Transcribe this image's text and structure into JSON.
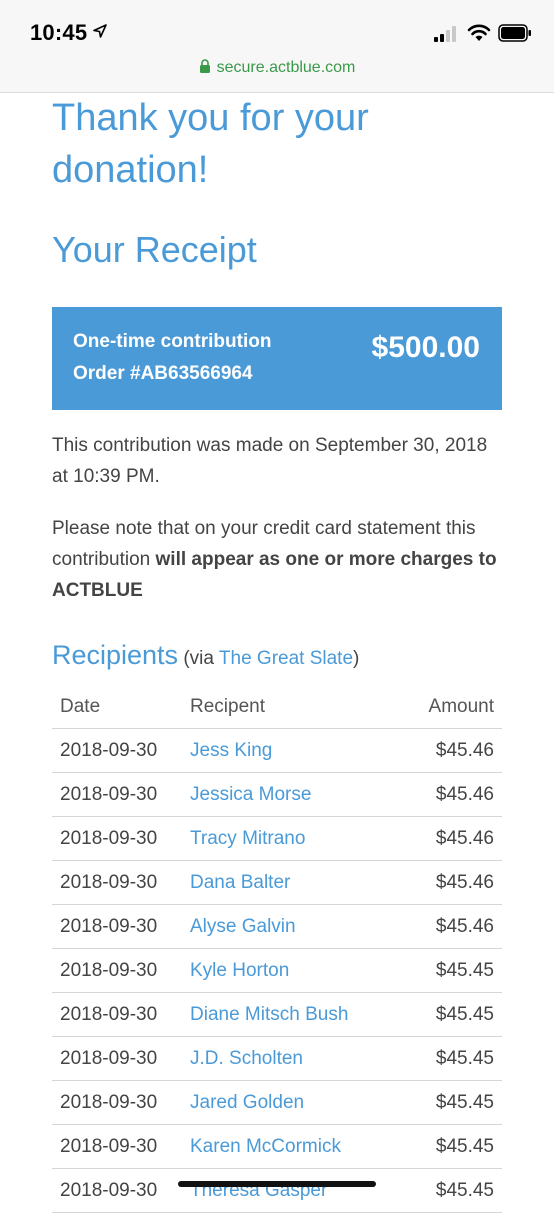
{
  "status_bar": {
    "time": "10:45",
    "icons": [
      "location-arrow-icon",
      "signal-bars-icon",
      "wifi-icon",
      "battery-icon"
    ]
  },
  "browser": {
    "url": "secure.actblue.com",
    "url_color": "#3a9a4a"
  },
  "page": {
    "heading_thank_you": "Thank you for your donation!",
    "heading_receipt": "Your Receipt",
    "accent_color": "#4a9ad8",
    "receipt": {
      "type": "One-time contribution",
      "order": "Order #AB63566964",
      "amount": "$500.00"
    },
    "contribution_made": "This contribution was made on September 30, 2018 at 10:39 PM.",
    "statement_note_prefix": "Please note that on your credit card statement this contribution ",
    "statement_note_bold": "will appear as one or more charges to ACTBLUE",
    "recipients": {
      "title": "Recipients",
      "via_open": " (via ",
      "via_link": "The Great Slate",
      "via_close": ")",
      "columns": [
        "Date",
        "Recipent",
        "Amount"
      ],
      "rows": [
        {
          "date": "2018-09-30",
          "recipient": "Jess King",
          "amount": "$45.46"
        },
        {
          "date": "2018-09-30",
          "recipient": "Jessica Morse",
          "amount": "$45.46"
        },
        {
          "date": "2018-09-30",
          "recipient": "Tracy Mitrano",
          "amount": "$45.46"
        },
        {
          "date": "2018-09-30",
          "recipient": "Dana Balter",
          "amount": "$45.46"
        },
        {
          "date": "2018-09-30",
          "recipient": "Alyse Galvin",
          "amount": "$45.46"
        },
        {
          "date": "2018-09-30",
          "recipient": "Kyle Horton",
          "amount": "$45.45"
        },
        {
          "date": "2018-09-30",
          "recipient": "Diane Mitsch Bush",
          "amount": "$45.45"
        },
        {
          "date": "2018-09-30",
          "recipient": "J.D. Scholten",
          "amount": "$45.45"
        },
        {
          "date": "2018-09-30",
          "recipient": "Jared Golden",
          "amount": "$45.45"
        },
        {
          "date": "2018-09-30",
          "recipient": "Karen McCormick",
          "amount": "$45.45"
        },
        {
          "date": "2018-09-30",
          "recipient": "Theresa Gasper",
          "amount": "$45.45"
        }
      ]
    }
  }
}
